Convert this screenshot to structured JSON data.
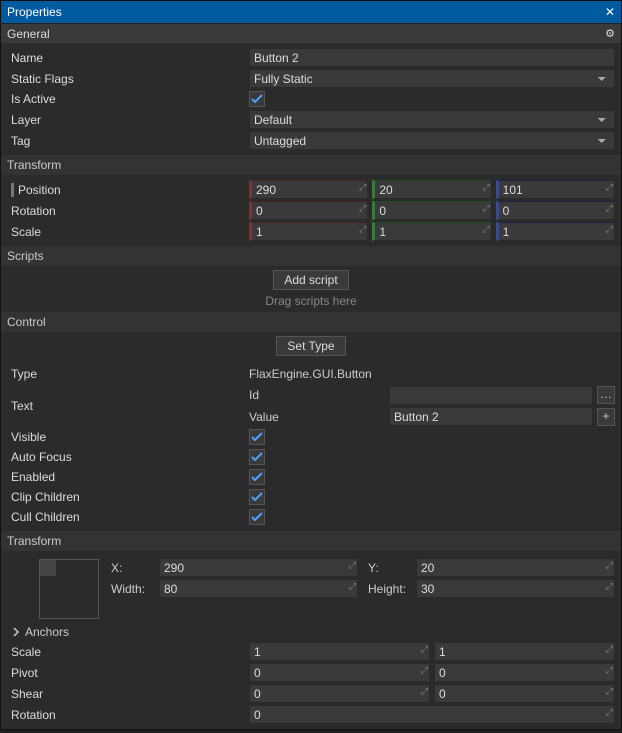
{
  "window": {
    "title": "Properties"
  },
  "sections": {
    "general": {
      "title": "General",
      "name_label": "Name",
      "name_value": "Button 2",
      "static_label": "Static Flags",
      "static_value": "Fully Static",
      "active_label": "Is Active",
      "active_checked": true,
      "layer_label": "Layer",
      "layer_value": "Default",
      "tag_label": "Tag",
      "tag_value": "Untagged"
    },
    "transform1": {
      "title": "Transform",
      "position_label": "Position",
      "position": {
        "x": "290",
        "y": "20",
        "z": "101"
      },
      "rotation_label": "Rotation",
      "rotation": {
        "x": "0",
        "y": "0",
        "z": "0"
      },
      "scale_label": "Scale",
      "scale": {
        "x": "1",
        "y": "1",
        "z": "1"
      }
    },
    "scripts": {
      "title": "Scripts",
      "add_label": "Add script",
      "hint": "Drag scripts here"
    },
    "control": {
      "title": "Control",
      "settype_label": "Set Type",
      "type_label": "Type",
      "type_value": "FlaxEngine.GUI.Button",
      "text_label": "Text",
      "id_label": "Id",
      "id_value": "",
      "value_label": "Value",
      "value_value": "Button 2",
      "visible_label": "Visible",
      "visible": true,
      "autofocus_label": "Auto Focus",
      "autofocus": true,
      "enabled_label": "Enabled",
      "enabled": true,
      "clip_label": "Clip Children",
      "clip": true,
      "cull_label": "Cull Children",
      "cull": true
    },
    "transform2": {
      "title": "Transform",
      "x_label": "X:",
      "x": "290",
      "y_label": "Y:",
      "y": "20",
      "w_label": "Width:",
      "w": "80",
      "h_label": "Height:",
      "h": "30",
      "anchors_label": "Anchors",
      "scale_label": "Scale",
      "scale": {
        "x": "1",
        "y": "1"
      },
      "pivot_label": "Pivot",
      "pivot": {
        "x": "0",
        "y": "0"
      },
      "shear_label": "Shear",
      "shear": {
        "x": "0",
        "y": "0"
      },
      "rotation_label": "Rotation",
      "rotation": "0"
    }
  }
}
